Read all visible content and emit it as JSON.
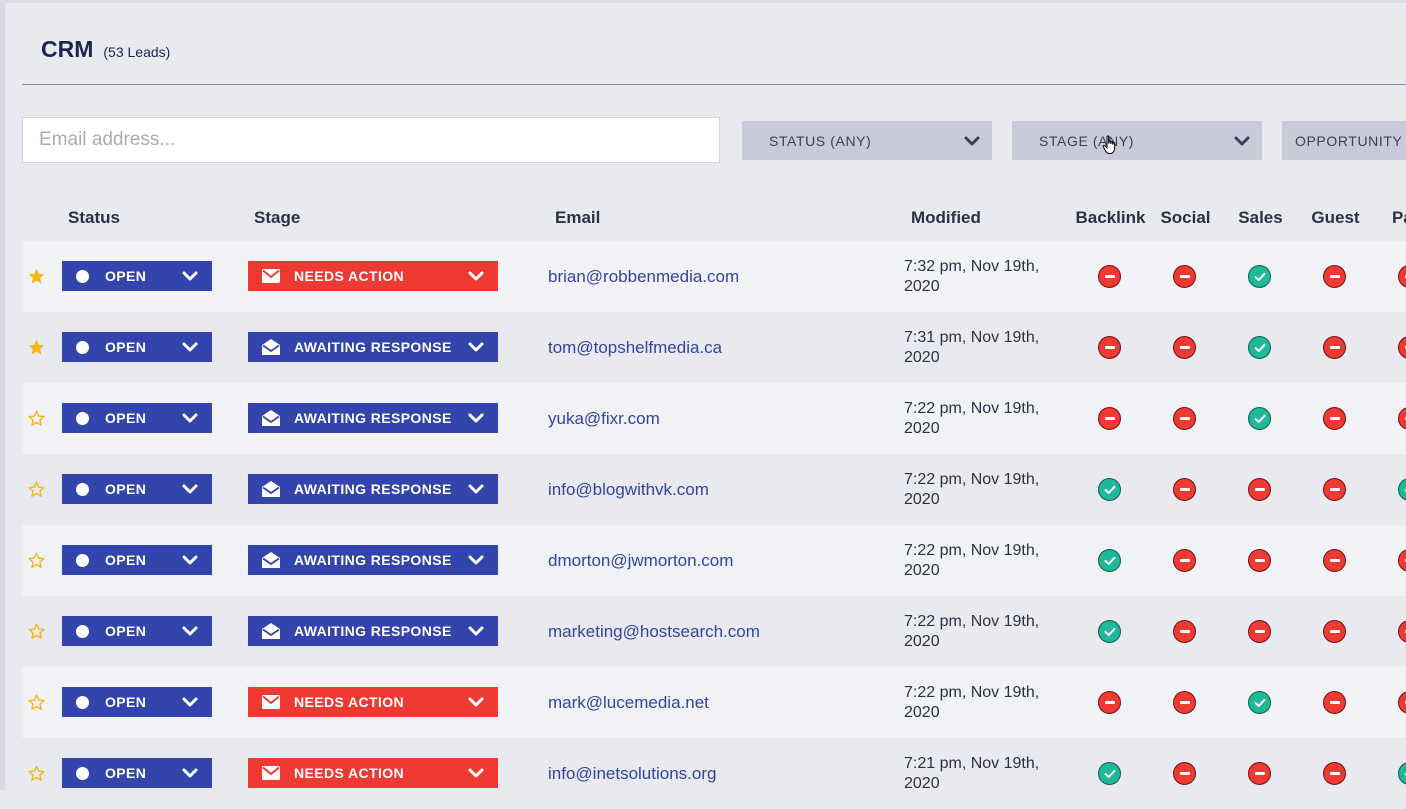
{
  "header": {
    "title": "CRM",
    "lead_count": "(53 Leads)"
  },
  "search": {
    "placeholder": "Email address...",
    "value": ""
  },
  "filters": [
    {
      "label": "STATUS (ANY)"
    },
    {
      "label": "STAGE (ANY)"
    },
    {
      "label": "OPPORTUNITY"
    }
  ],
  "columns": {
    "status": "Status",
    "stage": "Stage",
    "email": "Email",
    "modified": "Modified",
    "opportunities": [
      "Backlink",
      "Social",
      "Sales",
      "Guest",
      "Pa"
    ]
  },
  "colors": {
    "primary": "#3345ac",
    "needs_action": "#ee3a33",
    "yes": "#1fb89a",
    "no": "#ee3a33",
    "star": "#f4b71c"
  },
  "rows": [
    {
      "starred": true,
      "status": "OPEN",
      "stage": "NEEDS ACTION",
      "stage_type": "needs",
      "email": "brian@robbenmedia.com",
      "modified_time": "7:32 pm, Nov 19th,",
      "modified_year": "2020",
      "opps": [
        "no",
        "no",
        "yes",
        "no",
        "no"
      ]
    },
    {
      "starred": true,
      "status": "OPEN",
      "stage": "AWAITING RESPONSE",
      "stage_type": "awaiting",
      "email": "tom@topshelfmedia.ca",
      "modified_time": "7:31 pm, Nov 19th,",
      "modified_year": "2020",
      "opps": [
        "no",
        "no",
        "yes",
        "no",
        "no"
      ]
    },
    {
      "starred": false,
      "status": "OPEN",
      "stage": "AWAITING RESPONSE",
      "stage_type": "awaiting",
      "email": "yuka@fixr.com",
      "modified_time": "7:22 pm, Nov 19th,",
      "modified_year": "2020",
      "opps": [
        "no",
        "no",
        "yes",
        "no",
        "no"
      ]
    },
    {
      "starred": false,
      "status": "OPEN",
      "stage": "AWAITING RESPONSE",
      "stage_type": "awaiting",
      "email": "info@blogwithvk.com",
      "modified_time": "7:22 pm, Nov 19th,",
      "modified_year": "2020",
      "opps": [
        "yes",
        "no",
        "no",
        "no",
        "yes"
      ]
    },
    {
      "starred": false,
      "status": "OPEN",
      "stage": "AWAITING RESPONSE",
      "stage_type": "awaiting",
      "email": "dmorton@jwmorton.com",
      "modified_time": "7:22 pm, Nov 19th,",
      "modified_year": "2020",
      "opps": [
        "yes",
        "no",
        "no",
        "no",
        "no"
      ]
    },
    {
      "starred": false,
      "status": "OPEN",
      "stage": "AWAITING RESPONSE",
      "stage_type": "awaiting",
      "email": "marketing@hostsearch.com",
      "modified_time": "7:22 pm, Nov 19th,",
      "modified_year": "2020",
      "opps": [
        "yes",
        "no",
        "no",
        "no",
        "no"
      ]
    },
    {
      "starred": false,
      "status": "OPEN",
      "stage": "NEEDS ACTION",
      "stage_type": "needs",
      "email": "mark@lucemedia.net",
      "modified_time": "7:22 pm, Nov 19th,",
      "modified_year": "2020",
      "opps": [
        "no",
        "no",
        "yes",
        "no",
        "no"
      ]
    },
    {
      "starred": false,
      "status": "OPEN",
      "stage": "NEEDS ACTION",
      "stage_type": "needs",
      "email": "info@inetsolutions.org",
      "modified_time": "7:21 pm, Nov 19th,",
      "modified_year": "2020",
      "opps": [
        "yes",
        "no",
        "no",
        "no",
        "yes"
      ]
    }
  ]
}
